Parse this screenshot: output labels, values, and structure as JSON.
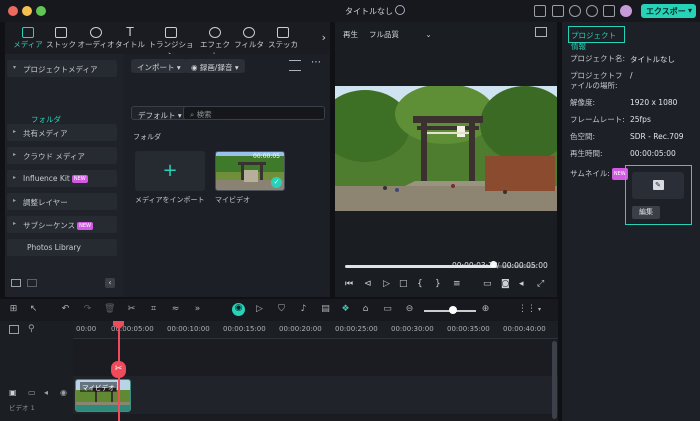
{
  "window": {
    "title": "タイトルなし"
  },
  "header": {
    "export_label": "エクスポート",
    "export_arrow": "▾"
  },
  "colors": {
    "accent": "#27d3b8",
    "playhead": "#ef4b5a",
    "new_badge": "#d05be0"
  },
  "media_tabs": [
    {
      "label": "メディア",
      "icon": "media-icon"
    },
    {
      "label": "ストック",
      "icon": "stock-icon"
    },
    {
      "label": "オーディオ",
      "icon": "music-note-icon"
    },
    {
      "label": "タイトル",
      "icon": "title-icon"
    },
    {
      "label": "トランジション",
      "icon": "transition-icon"
    },
    {
      "label": "エフェクト",
      "icon": "effect-icon"
    },
    {
      "label": "フィルター",
      "icon": "filter-icon"
    },
    {
      "label": "ステッカー",
      "icon": "sticker-icon"
    }
  ],
  "sidebar": {
    "items": [
      {
        "label": "プロジェクトメディア",
        "arrow": "▾"
      },
      {
        "label": "共有メディア",
        "arrow": "▸"
      },
      {
        "label": "クラウド メディア",
        "arrow": "▸"
      },
      {
        "label": "Influence Kit",
        "arrow": "▸",
        "badge": "NEW"
      },
      {
        "label": "調整レイヤー",
        "arrow": "▸"
      },
      {
        "label": "サブシーケンス",
        "arrow": "▸",
        "badge": "NEW"
      },
      {
        "label": "Photos Library"
      }
    ],
    "folder_label": "フォルダ"
  },
  "media": {
    "import_btn": "インポート ▾",
    "record_btn": "◉ 録画/録音 ▾",
    "sort_btn": "デフォルト ▾",
    "search_placeholder": "検索",
    "section_label": "フォルダ",
    "import_tile_label": "メディアをインポート",
    "import_tile_plus": "+",
    "video_label": "マイビデオ",
    "video_duration": "00:00:05",
    "check_mark": "✓"
  },
  "preview": {
    "play_label": "再生",
    "quality_label": "フル品質",
    "current_time": "00:00:03:23",
    "separator": "/",
    "total_time": "00:00:05:00",
    "progress": 0.77
  },
  "project_info": {
    "tab_label": "プロジェクト情報",
    "rows": [
      {
        "label": "プロジェクト名:",
        "value": "タイトルなし"
      },
      {
        "label": "プロジェクトファイルの場所:",
        "value": "/"
      },
      {
        "label": "解像度:",
        "value": "1920 x 1080"
      },
      {
        "label": "フレームレート:",
        "value": "25fps"
      },
      {
        "label": "色空間:",
        "value": "SDR - Rec.709"
      },
      {
        "label": "再生時間:",
        "value": "00:00:05:00"
      },
      {
        "label": "サムネイル:",
        "badge": "NEW"
      }
    ],
    "edit_label": "編集"
  },
  "timeline": {
    "ruler": [
      "00:00",
      "00:00:05:00",
      "00:00:10:00",
      "00:00:15:00",
      "00:00:20:00",
      "00:00:25:00",
      "00:00:30:00",
      "00:00:35:00",
      "00:00:40:00"
    ],
    "clip_label": "マイビデオ",
    "track_name": "ビデオ 1"
  }
}
